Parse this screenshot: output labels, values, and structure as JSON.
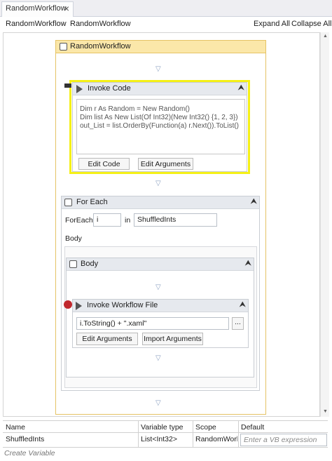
{
  "tab": {
    "label": "RandomWorkflow",
    "close_icon": "×"
  },
  "breadcrumb": {
    "items": [
      "RandomWorkflow",
      "RandomWorkflow"
    ],
    "separator": "›"
  },
  "toolbar": {
    "expand_all": "Expand All",
    "collapse_all": "Collapse All"
  },
  "sequence": {
    "title": "RandomWorkflow",
    "collapse_glyph": "∧"
  },
  "invoke_code": {
    "title": "Invoke Code",
    "code_lines": [
      "Dim r As Random = New Random()",
      "Dim list As New List(Of Int32)(New Int32() {1, 2, 3})",
      "out_List = list.OrderBy(Function(a) r.Next()).ToList()"
    ],
    "edit_code_label": "Edit Code",
    "edit_arguments_label": "Edit Arguments",
    "highlight_color": "#f5f017"
  },
  "for_each": {
    "title": "For Each",
    "foreach_label": "ForEach",
    "item_var": "i",
    "in_label": "in",
    "collection": "ShuffledInts",
    "body_label": "Body",
    "body_seq_title": "Body"
  },
  "invoke_workflow": {
    "title": "Invoke Workflow File",
    "path_expr": "i.ToString() + \".xaml\"",
    "browse_label": "...",
    "edit_arguments_label": "Edit Arguments",
    "import_arguments_label": "Import Arguments"
  },
  "variables": {
    "headers": [
      "Name",
      "Variable type",
      "Scope",
      "Default"
    ],
    "rows": [
      {
        "name": "ShuffledInts",
        "type": "List<Int32>",
        "scope": "RandomWorkf",
        "default_placeholder": "Enter a VB expression"
      }
    ],
    "create_label": "Create Variable"
  },
  "icons": {
    "drop_arrow": "▽",
    "collapse": "⮝",
    "scroll_up": "▲",
    "scroll_down": "▼"
  }
}
